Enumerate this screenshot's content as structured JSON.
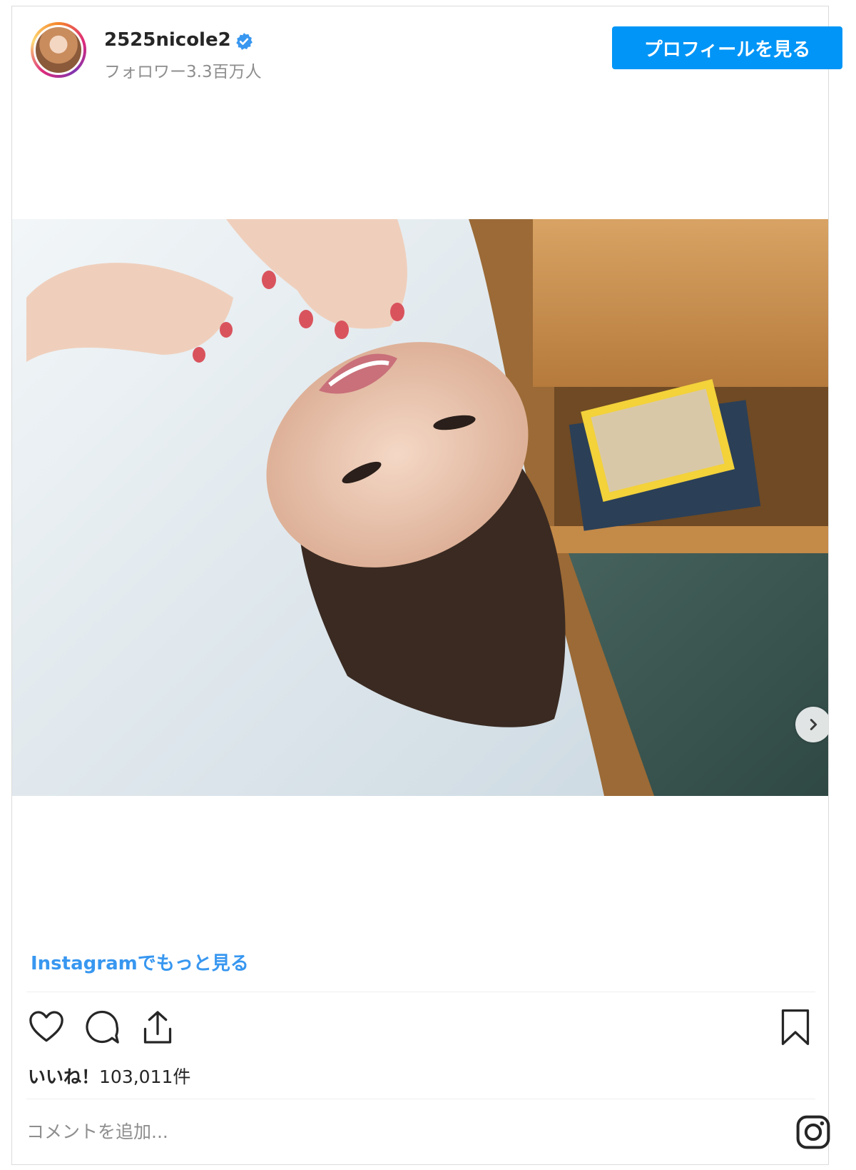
{
  "header": {
    "username": "2525nicole2",
    "followers": "フォロワー3.3百万人",
    "profile_button": "プロフィールを見る"
  },
  "post": {
    "more_link": "Instagramでもっと見る",
    "likes_label": "いいね！",
    "likes_count": "103,011件"
  },
  "comment": {
    "placeholder": "コメントを追加..."
  },
  "icons": [
    "verified-icon",
    "chevron-right-icon",
    "heart-icon",
    "comment-icon",
    "share-icon",
    "bookmark-icon",
    "instagram-logo-icon"
  ],
  "colors": {
    "accent": "#0095f6",
    "link": "#3897f0",
    "verified": "#3897f0"
  }
}
